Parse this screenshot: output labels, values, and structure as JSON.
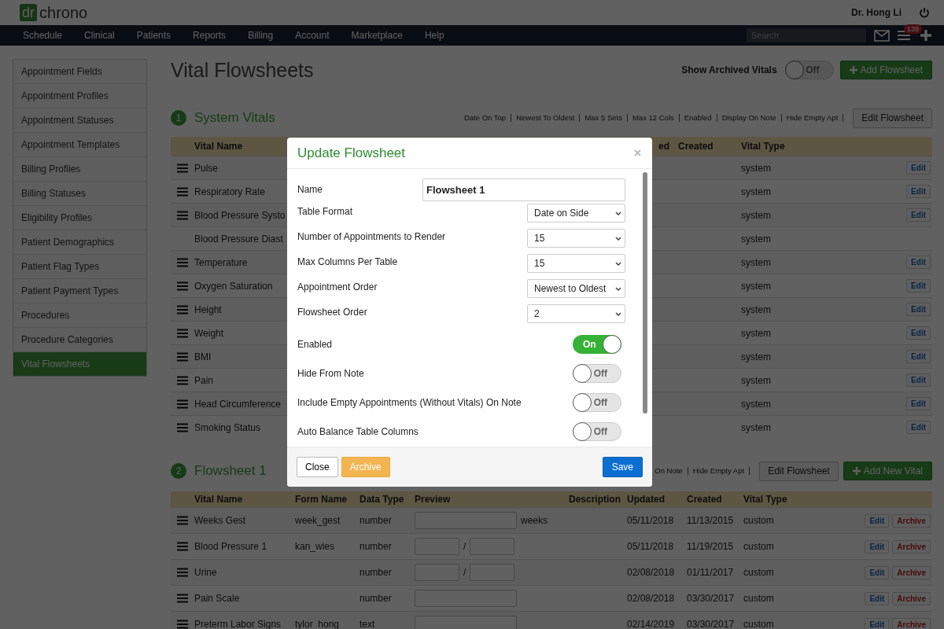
{
  "header": {
    "logo_mark": "dr",
    "logo_text": "chrono",
    "user": "Dr. Hong Li"
  },
  "nav": {
    "items": [
      "Schedule",
      "Clinical",
      "Patients",
      "Reports",
      "Billing",
      "Account",
      "Marketplace",
      "Help"
    ],
    "search_placeholder": "Search",
    "badge": "139"
  },
  "sidebar": {
    "items": [
      {
        "label": "Appointment Fields",
        "selected": false
      },
      {
        "label": "Appointment Profiles",
        "selected": false
      },
      {
        "label": "Appointment Statuses",
        "selected": false
      },
      {
        "label": "Appointment Templates",
        "selected": false
      },
      {
        "label": "Billing Profiles",
        "selected": false
      },
      {
        "label": "Billing Statuses",
        "selected": false
      },
      {
        "label": "Eligibility Profiles",
        "selected": false
      },
      {
        "label": "Patient Demographics",
        "selected": false
      },
      {
        "label": "Patient Flag Types",
        "selected": false
      },
      {
        "label": "Patient Payment Types",
        "selected": false
      },
      {
        "label": "Procedures",
        "selected": false
      },
      {
        "label": "Procedure Categories",
        "selected": false
      },
      {
        "label": "Vital Flowsheets",
        "selected": true
      }
    ]
  },
  "page": {
    "title": "Vital Flowsheets",
    "archived_toggle": {
      "label": "Show Archived Vitals",
      "on": false,
      "state_label": "Off"
    },
    "add_button": "Add Flowsheet"
  },
  "system_vitals": {
    "number": "1",
    "title": "System Vitals",
    "flags": [
      "Date On Top",
      "Newest To Oldest",
      "Max 5 Sets",
      "Max 12 Cols",
      "Enabled",
      "Display On Note",
      "Hide Empty Apt"
    ],
    "edit_button": "Edit Flowsheet",
    "columns": [
      "Vital Name",
      "ed",
      "Created",
      "Vital Type"
    ],
    "rows": [
      {
        "name": "Pulse",
        "draggable": true,
        "type": "system",
        "edit": "Edit"
      },
      {
        "name": "Respiratory Rate",
        "draggable": true,
        "type": "system",
        "edit": "Edit"
      },
      {
        "name": "Blood Pressure Systo",
        "draggable": true,
        "type": "system",
        "edit": "Edit"
      },
      {
        "name": "Blood Pressure Diast",
        "draggable": false,
        "type": "system"
      },
      {
        "name": "Temperature",
        "draggable": true,
        "type": "system",
        "edit": "Edit"
      },
      {
        "name": "Oxygen Saturation",
        "draggable": true,
        "type": "system",
        "edit": "Edit"
      },
      {
        "name": "Height",
        "draggable": true,
        "type": "system",
        "edit": "Edit"
      },
      {
        "name": "Weight",
        "draggable": true,
        "type": "system",
        "edit": "Edit"
      },
      {
        "name": "BMI",
        "draggable": true,
        "type": "system",
        "edit": "Edit"
      },
      {
        "name": "Pain",
        "draggable": true,
        "type": "system",
        "edit": "Edit"
      },
      {
        "name": "Head Circumference",
        "draggable": true,
        "type": "system",
        "edit": "Edit"
      },
      {
        "name": "Smoking Status",
        "draggable": true,
        "type": "system",
        "edit": "Edit"
      }
    ]
  },
  "flowsheet_1": {
    "number": "2",
    "title": "Flowsheet 1",
    "flags": [
      "On Note",
      "Hide Empty Apt"
    ],
    "edit_button": "Edit Flowsheet",
    "add_button": "Add New Vital",
    "columns": [
      "Vital Name",
      "Form Name",
      "Data Type",
      "Preview",
      "Description",
      "Updated",
      "Created",
      "Vital Type"
    ],
    "rows": [
      {
        "name": "Weeks Gest",
        "form_name": "week_gest",
        "data_type": "number",
        "preview": {
          "kind": "single",
          "suffix": "weeks"
        },
        "updated": "05/11/2018",
        "created": "11/13/2015",
        "type": "custom",
        "edit": "Edit",
        "archive": "Archive"
      },
      {
        "name": "Blood Pressure 1",
        "form_name": "kan_wies",
        "data_type": "number",
        "preview": {
          "kind": "pair",
          "separator": "/"
        },
        "updated": "05/11/2018",
        "created": "11/19/2015",
        "type": "custom",
        "edit": "Edit",
        "archive": "Archive"
      },
      {
        "name": "Urine",
        "data_type": "number",
        "preview": {
          "kind": "pair",
          "separator": "/"
        },
        "updated": "02/08/2018",
        "created": "01/11/2017",
        "type": "custom",
        "edit": "Edit",
        "archive": "Archive"
      },
      {
        "name": "Pain Scale",
        "data_type": "number",
        "preview": {
          "kind": "single"
        },
        "updated": "02/08/2018",
        "created": "03/30/2017",
        "type": "custom",
        "edit": "Edit",
        "archive": "Archive"
      },
      {
        "name": "Preterm Labor Signs",
        "form_name": "tylor_hong",
        "data_type": "text",
        "preview": {
          "kind": "single"
        },
        "updated": "02/14/2019",
        "created": "03/30/2017",
        "type": "custom",
        "edit": "Edit",
        "archive": "Archive"
      }
    ]
  },
  "modal": {
    "title": "Update Flowsheet",
    "fields": [
      {
        "kind": "text",
        "label": "Name",
        "value": "Flowsheet 1"
      },
      {
        "kind": "select",
        "label": "Table Format",
        "value": "Date on Side"
      },
      {
        "kind": "select",
        "label": "Number of Appointments to Render",
        "value": "15"
      },
      {
        "kind": "select",
        "label": "Max Columns Per Table",
        "value": "15"
      },
      {
        "kind": "select",
        "label": "Appointment Order",
        "value": "Newest to Oldest"
      },
      {
        "kind": "select",
        "label": "Flowsheet Order",
        "value": "2"
      },
      {
        "kind": "toggle",
        "label": "Enabled",
        "on": true,
        "state_label": "On"
      },
      {
        "kind": "toggle",
        "label": "Hide From Note",
        "on": false,
        "state_label": "Off"
      },
      {
        "kind": "toggle",
        "label": "Include Empty Appointments (Without Vitals) On Note",
        "on": false,
        "state_label": "Off"
      },
      {
        "kind": "toggle",
        "label": "Auto Balance Table Columns",
        "on": false,
        "state_label": "Off"
      }
    ],
    "buttons": {
      "close": "Close",
      "archive": "Archive",
      "save": "Save"
    }
  }
}
